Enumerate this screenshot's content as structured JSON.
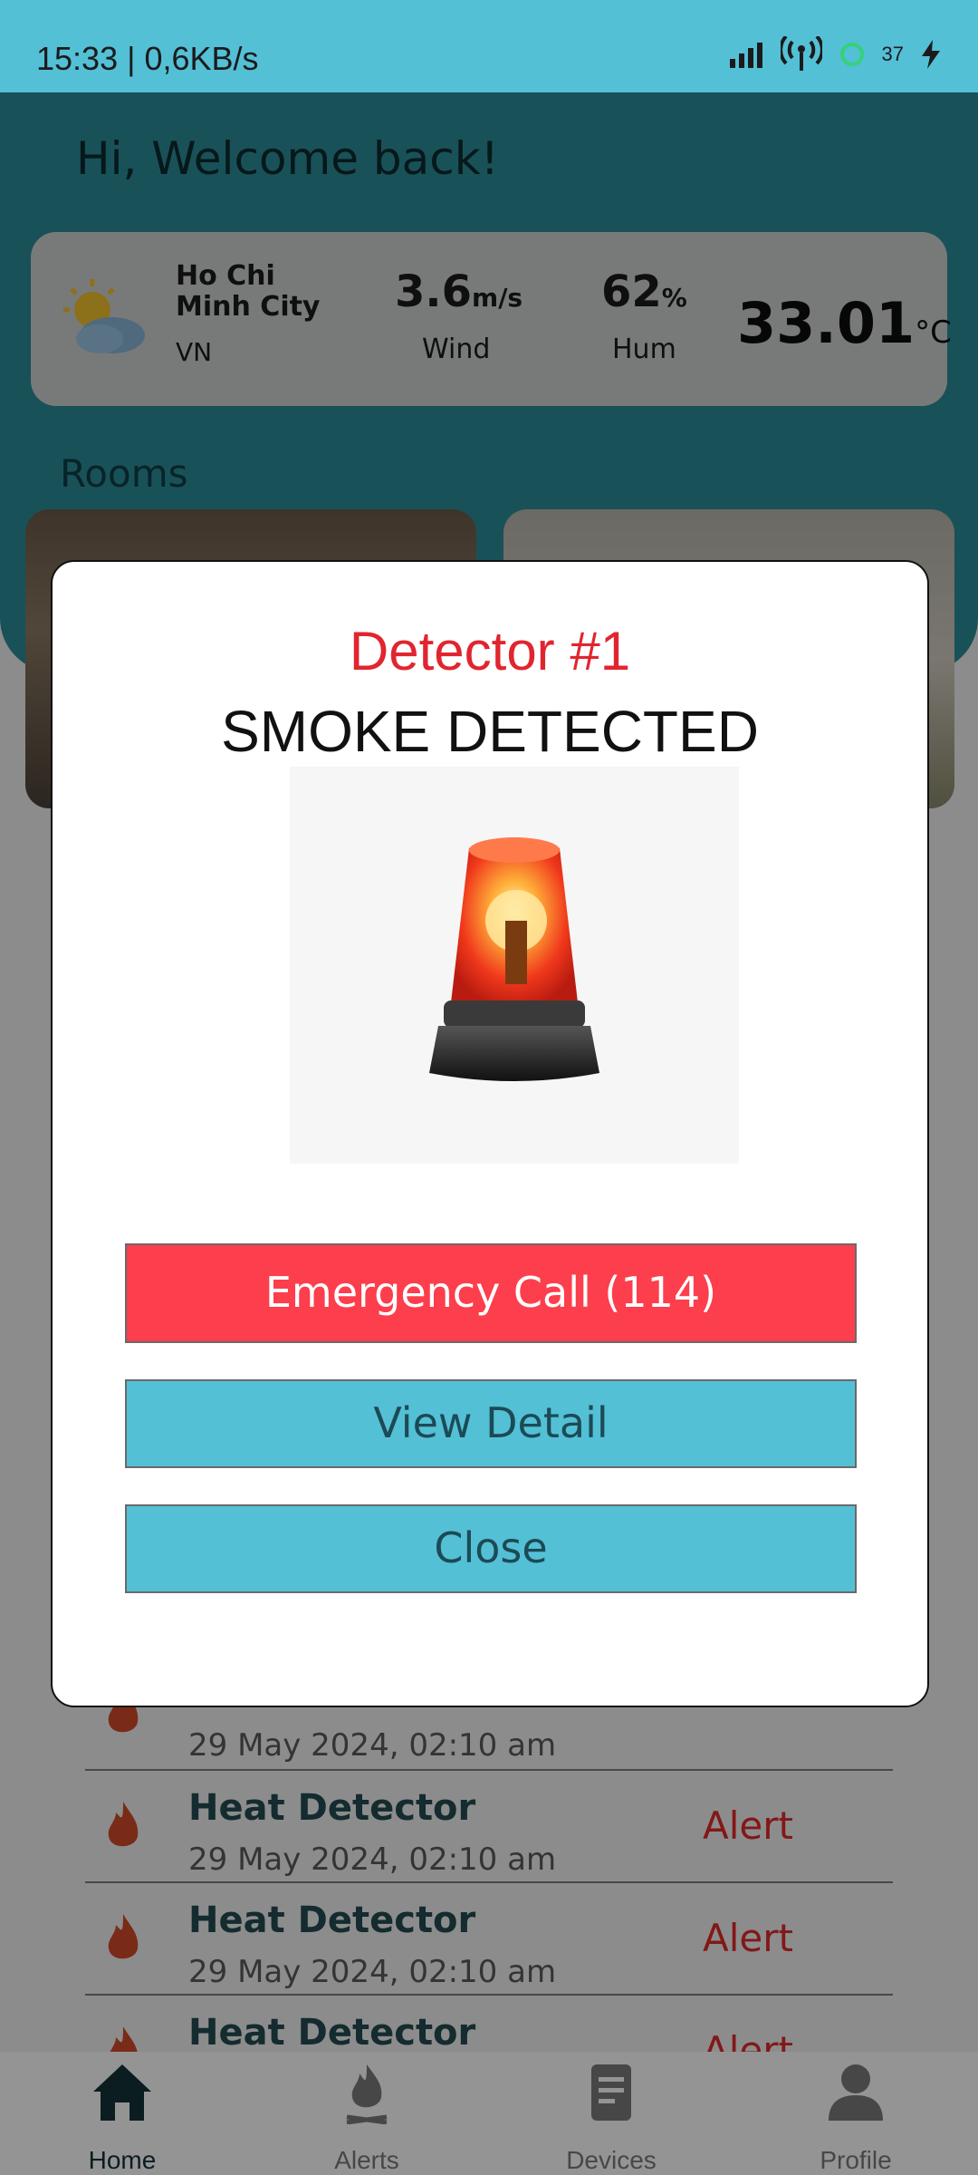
{
  "status_bar": {
    "time": "15:33 | 0,6KB/s",
    "battery": "37"
  },
  "home": {
    "welcome": "Hi, Welcome back!",
    "weather": {
      "city": "Ho Chi Minh City",
      "country": "VN",
      "wind_value": "3.6",
      "wind_unit": "m/s",
      "wind_label": "Wind",
      "humidity_value": "62",
      "humidity_unit": "%",
      "humidity_label": "Hum",
      "temperature_value": "33.01",
      "temperature_unit": "°C"
    },
    "rooms_title": "Rooms",
    "alerts": [
      {
        "title": "",
        "date": "29 May 2024, 02:10 am",
        "status": ""
      },
      {
        "title": "Heat Detector",
        "date": "29 May 2024, 02:10 am",
        "status": "Alert"
      },
      {
        "title": "Heat Detector",
        "date": "29 May 2024, 02:10 am",
        "status": "Alert"
      },
      {
        "title": "Heat Detector",
        "date": "",
        "status": "Alert"
      }
    ]
  },
  "dialog": {
    "title": "Detector #1",
    "subtitle": "SMOKE DETECTED",
    "image_icon": "alarm-siren-icon",
    "emergency_label": "Emergency Call (114)",
    "view_label": "View Detail",
    "close_label": "Close"
  },
  "bottom_nav": {
    "items": [
      {
        "label": "Home",
        "icon": "home-icon",
        "active": true
      },
      {
        "label": "Alerts",
        "icon": "fire-icon",
        "active": false
      },
      {
        "label": "Devices",
        "icon": "device-icon",
        "active": false
      },
      {
        "label": "Profile",
        "icon": "profile-icon",
        "active": false
      }
    ]
  },
  "colors": {
    "accent": "#53c0d6",
    "danger": "#fd3e4c",
    "title_red": "#e1252f"
  }
}
